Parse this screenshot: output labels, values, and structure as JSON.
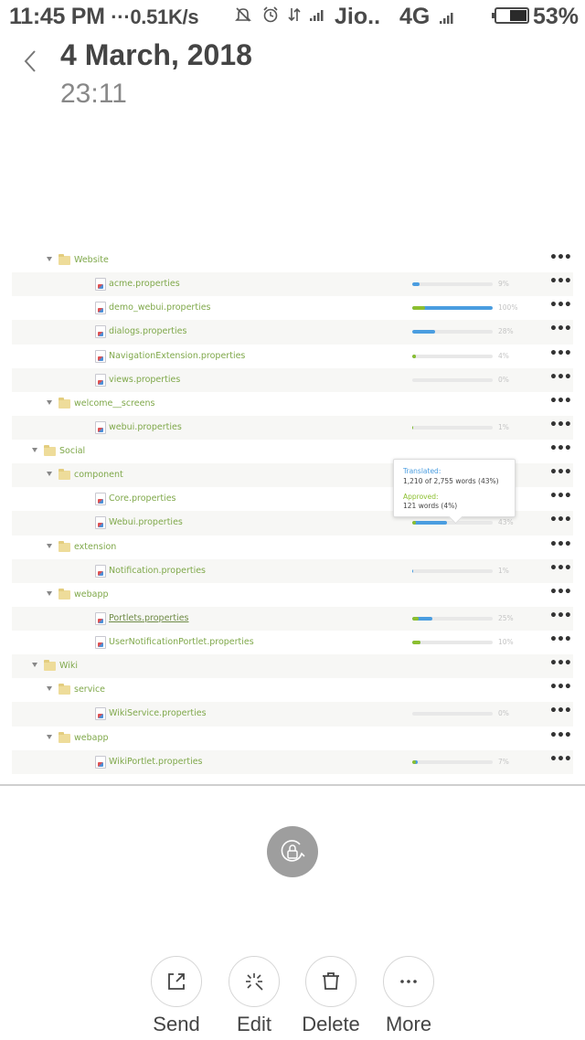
{
  "status_bar": {
    "time": "11:45 PM",
    "speed": "···0.51K/s",
    "carrier": "Jio..",
    "network": "4G",
    "battery_pct": "53%",
    "battery_level": 0.53,
    "icons": [
      "mute-icon",
      "alarm-icon",
      "data-transfer-icon",
      "signal-icon",
      "signal-icon"
    ]
  },
  "header": {
    "title": "4 March, 2018",
    "subtitle": "23:11"
  },
  "tree": [
    {
      "type": "folder",
      "depth": 1,
      "name": "Website"
    },
    {
      "type": "file",
      "depth": 2,
      "name": "acme.properties",
      "translated": 9,
      "approved": 0,
      "pct_label": "9%"
    },
    {
      "type": "file",
      "depth": 2,
      "name": "demo_webui.properties",
      "translated": 100,
      "approved": 16,
      "pct_label": "100%"
    },
    {
      "type": "file",
      "depth": 2,
      "name": "dialogs.properties",
      "translated": 28,
      "approved": 0,
      "pct_label": "28%"
    },
    {
      "type": "file",
      "depth": 2,
      "name": "NavigationExtension.properties",
      "translated": 4,
      "approved": 4,
      "pct_label": "4%"
    },
    {
      "type": "file",
      "depth": 2,
      "name": "views.properties",
      "translated": 0,
      "approved": 0,
      "pct_label": "0%"
    },
    {
      "type": "folder",
      "depth": 1,
      "name": "welcome__screens"
    },
    {
      "type": "file",
      "depth": 2,
      "name": "webui.properties",
      "translated": 1,
      "approved": 1,
      "pct_label": "1%"
    },
    {
      "type": "folder",
      "depth": 0,
      "name": "Social"
    },
    {
      "type": "folder",
      "depth": 1,
      "name": "component"
    },
    {
      "type": "file",
      "depth": 2,
      "name": "Core.properties",
      "translated": null,
      "approved": null,
      "pct_label": ""
    },
    {
      "type": "file",
      "depth": 2,
      "name": "Webui.properties",
      "translated": 43,
      "approved": 4,
      "pct_label": "43%"
    },
    {
      "type": "folder",
      "depth": 1,
      "name": "extension"
    },
    {
      "type": "file",
      "depth": 2,
      "name": "Notification.properties",
      "translated": 1,
      "approved": 0,
      "pct_label": "1%"
    },
    {
      "type": "folder",
      "depth": 1,
      "name": "webapp"
    },
    {
      "type": "file",
      "depth": 2,
      "name": "Portlets.properties",
      "translated": 25,
      "approved": 8,
      "pct_label": "25%",
      "underline": true
    },
    {
      "type": "file",
      "depth": 2,
      "name": "UserNotificationPortlet.properties",
      "translated": 10,
      "approved": 10,
      "pct_label": "10%"
    },
    {
      "type": "folder",
      "depth": 0,
      "name": "Wiki"
    },
    {
      "type": "folder",
      "depth": 1,
      "name": "service"
    },
    {
      "type": "file",
      "depth": 2,
      "name": "WikiService.properties",
      "translated": 0,
      "approved": 0,
      "pct_label": "0%"
    },
    {
      "type": "folder",
      "depth": 1,
      "name": "webapp"
    },
    {
      "type": "file",
      "depth": 2,
      "name": "WikiPortlet.properties",
      "translated": 7,
      "approved": 5,
      "pct_label": "7%"
    }
  ],
  "more_label": "•••",
  "tooltip": {
    "translated_label": "Translated:",
    "translated_value": "1,210 of 2,755 words (43%)",
    "approved_label": "Approved:",
    "approved_value": "121 words (4%)"
  },
  "colors": {
    "translated": "#4a9de0",
    "approved": "#8cbf2f",
    "link": "#7fa84a"
  },
  "actions": [
    {
      "id": "send",
      "label": "Send",
      "icon": "share-icon"
    },
    {
      "id": "edit",
      "label": "Edit",
      "icon": "magic-wand-icon"
    },
    {
      "id": "delete",
      "label": "Delete",
      "icon": "trash-icon"
    },
    {
      "id": "more",
      "label": "More",
      "icon": "more-icon"
    }
  ]
}
